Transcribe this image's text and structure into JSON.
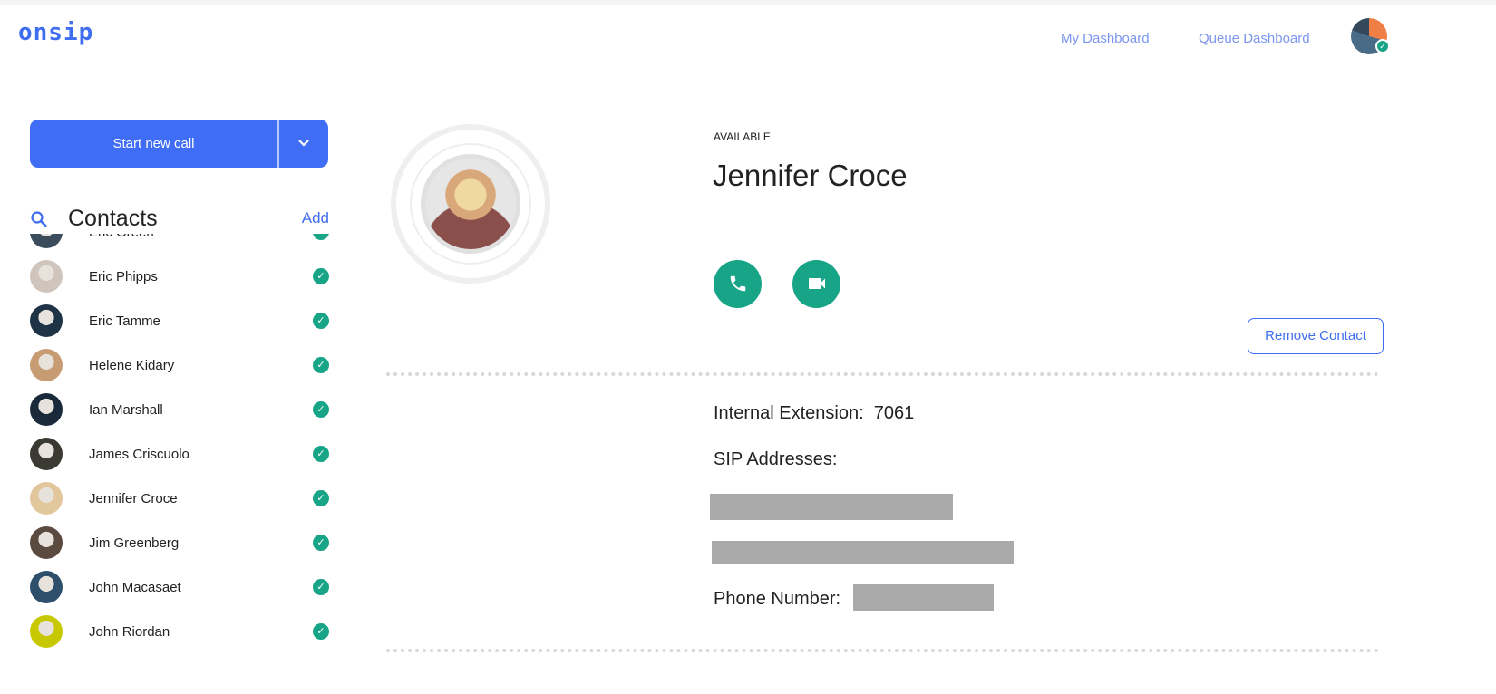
{
  "header": {
    "logo": "onsip",
    "nav": [
      "My Dashboard",
      "Queue Dashboard"
    ]
  },
  "sidebar": {
    "start_call": "Start new call",
    "contacts_title": "Contacts",
    "add_label": "Add",
    "contacts": [
      {
        "name": "Eric Green",
        "avatar": "#3b4d5c"
      },
      {
        "name": "Eric Phipps",
        "avatar": "#cfc5bd"
      },
      {
        "name": "Eric Tamme",
        "avatar": "#1e3346"
      },
      {
        "name": "Helene Kidary",
        "avatar": "#c79c72"
      },
      {
        "name": "Ian Marshall",
        "avatar": "#1b2a3a"
      },
      {
        "name": "James Criscuolo",
        "avatar": "#3a3a32"
      },
      {
        "name": "Jennifer Croce",
        "avatar": "#e3c79c"
      },
      {
        "name": "Jim Greenberg",
        "avatar": "#5a4a40"
      },
      {
        "name": "John Macasaet",
        "avatar": "#2e4f6b"
      },
      {
        "name": "John Riordan",
        "avatar": "#c8c800"
      }
    ]
  },
  "contact": {
    "status": "AVAILABLE",
    "name": "Jennifer Croce",
    "remove_label": "Remove Contact",
    "extension_label": "Internal Extension:",
    "extension": "7061",
    "sip_label": "SIP Addresses:",
    "phone_label": "Phone Number:"
  },
  "colors": {
    "accent": "#3f6df5",
    "online": "#18a587"
  }
}
